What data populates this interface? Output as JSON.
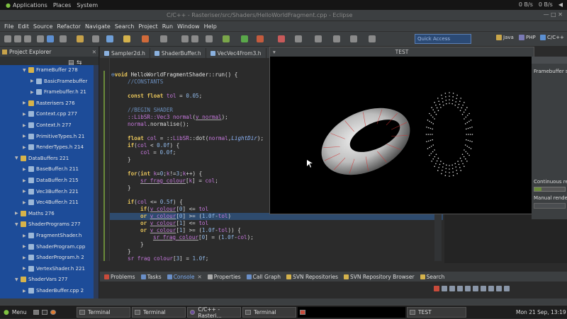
{
  "topbar": {
    "applications": "Applications",
    "places": "Places",
    "system": "System",
    "window_title": "C/C++ - Rasteriser/src/Shaders/HelloWorldFragment.cpp - Eclipse",
    "net_down": "0 B/s",
    "net_up": "0 B/s"
  },
  "menu": [
    "File",
    "Edit",
    "Source",
    "Refactor",
    "Navigate",
    "Search",
    "Project",
    "Run",
    "Window",
    "Help"
  ],
  "quick_access": "Quick Access",
  "perspectives": [
    "Java",
    "PHP",
    "C/C++"
  ],
  "explorer": {
    "title": "Project Explorer",
    "items": [
      {
        "label": "FrameBuffer 278",
        "indent": 2,
        "type": "folder",
        "arrow": "▼"
      },
      {
        "label": "BasicFramebuffer",
        "indent": 3,
        "type": "file",
        "arrow": "▶"
      },
      {
        "label": "Framebuffer.h 21",
        "indent": 3,
        "type": "file",
        "arrow": "▶"
      },
      {
        "label": "Rasterisers 276",
        "indent": 2,
        "type": "folder",
        "arrow": "▶"
      },
      {
        "label": "Context.cpp 277",
        "indent": 2,
        "type": "file",
        "arrow": "▶"
      },
      {
        "label": "Context.h 277",
        "indent": 2,
        "type": "file",
        "arrow": "▶"
      },
      {
        "label": "PrimitiveTypes.h 21",
        "indent": 2,
        "type": "file",
        "arrow": "▶"
      },
      {
        "label": "RenderTypes.h 214",
        "indent": 2,
        "type": "file",
        "arrow": "▶"
      },
      {
        "label": "DataBuffers 221",
        "indent": 1,
        "type": "folder",
        "arrow": "▼"
      },
      {
        "label": "BaseBuffer.h 211",
        "indent": 2,
        "type": "file",
        "arrow": "▶"
      },
      {
        "label": "DataBuffer.h 215",
        "indent": 2,
        "type": "file",
        "arrow": "▶"
      },
      {
        "label": "Vec3Buffer.h 221",
        "indent": 2,
        "type": "file",
        "arrow": "▶"
      },
      {
        "label": "Vec4Buffer.h 211",
        "indent": 2,
        "type": "file",
        "arrow": "▶"
      },
      {
        "label": "Maths 276",
        "indent": 1,
        "type": "folder",
        "arrow": "▶"
      },
      {
        "label": "ShaderPrograms 277",
        "indent": 1,
        "type": "folder",
        "arrow": "▼"
      },
      {
        "label": "FragmentShader.h",
        "indent": 2,
        "type": "file",
        "arrow": "▶"
      },
      {
        "label": "ShaderProgram.cpp",
        "indent": 2,
        "type": "file",
        "arrow": "▶"
      },
      {
        "label": "ShaderProgram.h 2",
        "indent": 2,
        "type": "file",
        "arrow": "▶"
      },
      {
        "label": "VertexShader.h 221",
        "indent": 2,
        "type": "file",
        "arrow": "▶"
      },
      {
        "label": "ShaderVars 277",
        "indent": 1,
        "type": "folder",
        "arrow": "▼"
      },
      {
        "label": "ShaderBuffer.cpp 2",
        "indent": 2,
        "type": "file",
        "arrow": "▶"
      }
    ]
  },
  "tabs": [
    "Sampler2d.h",
    "ShaderBuffer.h",
    "VecVec4From3.h"
  ],
  "test_window": {
    "title": "TEST"
  },
  "outline": {
    "label1": "Framebuffer s",
    "label2": "Continuous ren",
    "label3": "Manual render"
  },
  "bottom_tabs": [
    "Problems",
    "Tasks",
    "Console",
    "Properties",
    "Call Graph",
    "SVN Repositories",
    "SVN Repository Browser",
    "Search"
  ],
  "taskbar": {
    "menu": "Menu",
    "items": [
      "Terminal",
      "Terminal",
      "C/C++ - Rasteri...",
      "Terminal",
      "TEST"
    ],
    "clock": "Mon 21 Sep, 13:19"
  },
  "colors": {
    "explorer_bg": "#1d4c99",
    "editor_bg": "#2b2b2b",
    "keyword": "#e8c55a",
    "comment": "#6b8fbf"
  }
}
